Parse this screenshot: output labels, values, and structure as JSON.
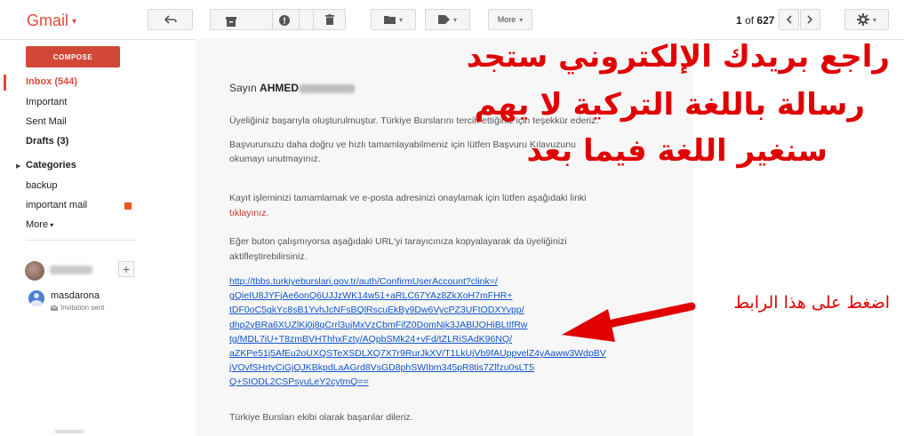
{
  "app": {
    "logo": "Gmail"
  },
  "toolbar": {
    "more_label": "More",
    "pager": {
      "current": "1",
      "of": "of",
      "total": "627"
    }
  },
  "sidebar": {
    "compose_label": "COMPOSE",
    "items": [
      {
        "label": "Inbox (544)"
      },
      {
        "label": "Important"
      },
      {
        "label": "Sent Mail"
      },
      {
        "label": "Drafts (3)"
      },
      {
        "label": "Categories"
      },
      {
        "label": "backup"
      },
      {
        "label": "important mail"
      },
      {
        "label": "More"
      }
    ],
    "label_color": "#f4511e",
    "contact": {
      "name": "masdarona",
      "status": "Invitation sent"
    }
  },
  "message": {
    "greeting_prefix": "Sayın",
    "greeting_name": "AHMED",
    "lines": [
      "Üyeliğiniz başarıyla oluşturulmuştur. Türkiye Burslarını tercih ettiğiniz için teşekkür ederiz.",
      "Başvurunuzu daha doğru ve hızlı tamamlayabilmeniz için lütfen Başvuru Kılavuzunu",
      "okumayı unutmayınız.",
      "Kayıt işleminizi tamamlamak ve e-posta adresinizi onaylamak için lütfen aşağıdaki linki",
      "tıklayınız.",
      "Eğer buton çalışmıyorsa aşağıdaki URL'yi tarayıcınıza kopyalayarak da üyeliğinizi",
      "aktifleştirebilirsiniz.",
      "Türkiye Bursları ekibi olarak başarılar dileriz."
    ],
    "link_lines": [
      "http://tbbs.turkiyeburslari.gov.tr/auth/ConfirmUserAccount?clink=/",
      "gQieIU8JYFjAe6onQ6UJJzWK14w51+aRLC67YAz8ZkXoH7mFHR+",
      "tDF0oC5gkYc8sB1YvhJcNFsBQlRscuEkBy9Dw6VycPZ3UFtODXYvpp/",
      "dhp2yBRa6XUZlKj0j8qCrrl3ujMxVzCbmFifZ0DomNjk3JABlJOHiBLtIfRw",
      "tg/MDL7iU+T8zmBVHThhxFzty/AQpbSMk24+vFd/tZLRiSAdK96NQ/",
      "aZKPe51j5AfEu2oUXQSTeXSDLXQ7X7r9RurJkXV/T1LkUjVb9fAUppvelZ4yAaww3WdpBV",
      "jVOvfSHrtyCiGjQJKBkpdLaAGrd8VsGD8phSWIbm345pR8tis7Zlfzu0sLT5",
      "Q+SIODL2CSPsyuLeY2cytmQ=="
    ]
  },
  "annotations": {
    "line1": "راجع بريدك الإلكتروني ستجد",
    "line2": "رسالة باللغة التركية لا يهم",
    "line3": "سنغير اللغة فيما بعد",
    "arrow_label": "اضغط على هذا الرابط",
    "color": "#e00000"
  }
}
